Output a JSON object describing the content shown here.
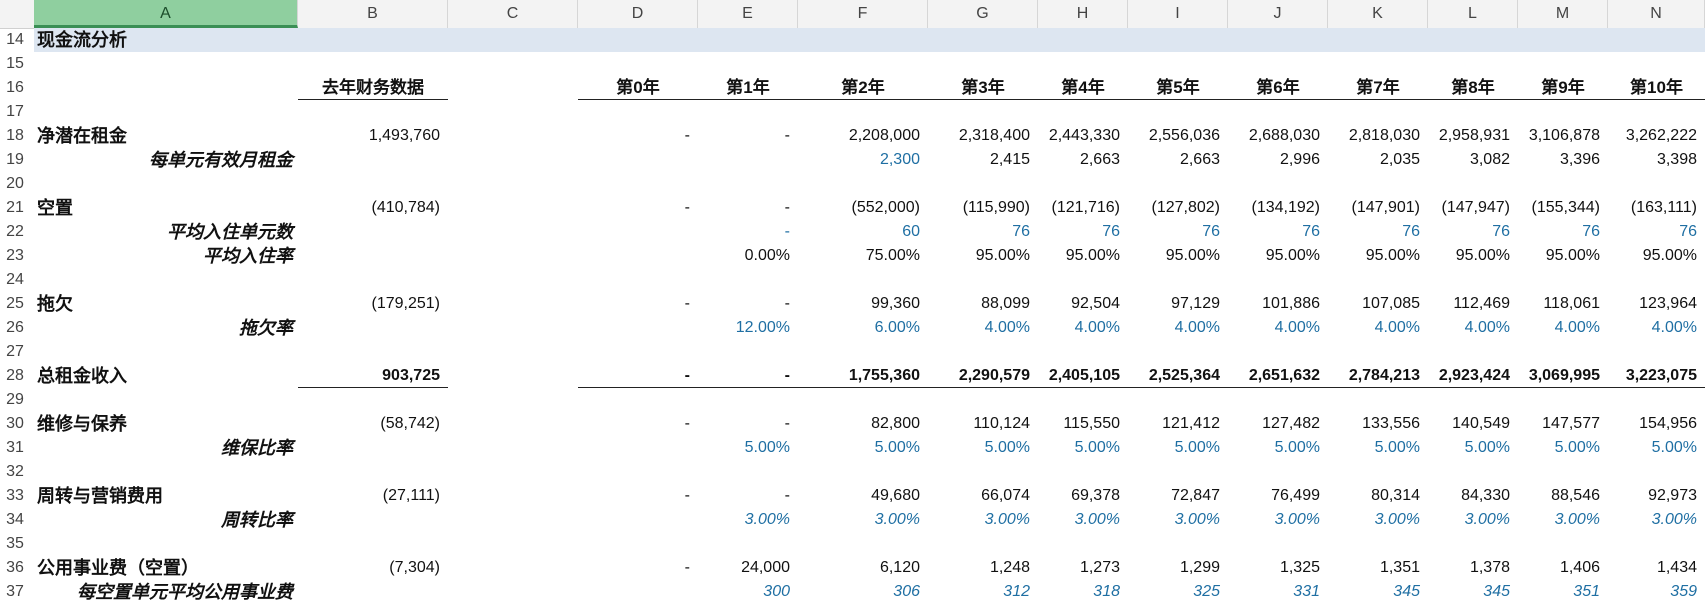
{
  "columns": [
    "A",
    "B",
    "C",
    "D",
    "E",
    "F",
    "G",
    "H",
    "I",
    "J",
    "K",
    "L",
    "M",
    "N"
  ],
  "selected_column": "A",
  "rows": [
    {
      "n": "14",
      "a": "现金流分析",
      "style": "title"
    },
    {
      "n": "15"
    },
    {
      "n": "16",
      "b": "去年财务数据",
      "years": [
        "第0年",
        "第1年",
        "第2年",
        "第3年",
        "第4年",
        "第5年",
        "第6年",
        "第7年",
        "第8年",
        "第9年",
        "第10年"
      ],
      "style": "header"
    },
    {
      "n": "17"
    },
    {
      "n": "18",
      "a": "净潜在租金",
      "b": "1,493,760",
      "v": [
        "-",
        "-",
        "2,208,000",
        "2,318,400",
        "2,443,330",
        "2,556,036",
        "2,688,030",
        "2,818,030",
        "2,958,931",
        "3,106,878",
        "3,262,222"
      ]
    },
    {
      "n": "19",
      "sub": "每单元有效月租金",
      "v": [
        "",
        "",
        "2,300",
        "2,415",
        "2,663",
        "2,663",
        "2,996",
        "2,035",
        "3,082",
        "3,396",
        "3,398"
      ],
      "blue": [
        2
      ]
    },
    {
      "n": "20"
    },
    {
      "n": "21",
      "a": "空置",
      "b": "(410,784)",
      "v": [
        "-",
        "-",
        "(552,000)",
        "(115,990)",
        "(121,716)",
        "(127,802)",
        "(134,192)",
        "(147,901)",
        "(147,947)",
        "(155,344)",
        "(163,111)"
      ]
    },
    {
      "n": "22",
      "sub": "平均入住单元数",
      "v": [
        "",
        "-",
        "60",
        "76",
        "76",
        "76",
        "76",
        "76",
        "76",
        "76",
        "76"
      ],
      "blue": [
        1,
        2,
        3,
        4,
        5,
        6,
        7,
        8,
        9,
        10
      ]
    },
    {
      "n": "23",
      "sub": "平均入住率",
      "v": [
        "",
        "0.00%",
        "75.00%",
        "95.00%",
        "95.00%",
        "95.00%",
        "95.00%",
        "95.00%",
        "95.00%",
        "95.00%",
        "95.00%"
      ]
    },
    {
      "n": "24"
    },
    {
      "n": "25",
      "a": "拖欠",
      "b": "(179,251)",
      "v": [
        "-",
        "-",
        "99,360",
        "88,099",
        "92,504",
        "97,129",
        "101,886",
        "107,085",
        "112,469",
        "118,061",
        "123,964"
      ]
    },
    {
      "n": "26",
      "sub": "拖欠率",
      "v": [
        "",
        "12.00%",
        "6.00%",
        "4.00%",
        "4.00%",
        "4.00%",
        "4.00%",
        "4.00%",
        "4.00%",
        "4.00%",
        "4.00%"
      ],
      "blue": [
        1,
        2,
        3,
        4,
        5,
        6,
        7,
        8,
        9,
        10
      ]
    },
    {
      "n": "27"
    },
    {
      "n": "28",
      "a": "总租金收入",
      "b": "903,725",
      "v": [
        "-",
        "-",
        "1,755,360",
        "2,290,579",
        "2,405,105",
        "2,525,364",
        "2,651,632",
        "2,784,213",
        "2,923,424",
        "3,069,995",
        "3,223,075"
      ],
      "style": "total"
    },
    {
      "n": "29"
    },
    {
      "n": "30",
      "a": "维修与保养",
      "b": "(58,742)",
      "v": [
        "-",
        "-",
        "82,800",
        "110,124",
        "115,550",
        "121,412",
        "127,482",
        "133,556",
        "140,549",
        "147,577",
        "154,956"
      ]
    },
    {
      "n": "31",
      "sub": "维保比率",
      "v": [
        "",
        "5.00%",
        "5.00%",
        "5.00%",
        "5.00%",
        "5.00%",
        "5.00%",
        "5.00%",
        "5.00%",
        "5.00%",
        "5.00%"
      ],
      "blue": [
        1,
        2,
        3,
        4,
        5,
        6,
        7,
        8,
        9,
        10
      ]
    },
    {
      "n": "32"
    },
    {
      "n": "33",
      "a": "周转与营销费用",
      "b": "(27,111)",
      "v": [
        "-",
        "-",
        "49,680",
        "66,074",
        "69,378",
        "72,847",
        "76,499",
        "80,314",
        "84,330",
        "88,546",
        "92,973"
      ]
    },
    {
      "n": "34",
      "sub": "周转比率",
      "v": [
        "",
        "3.00%",
        "3.00%",
        "3.00%",
        "3.00%",
        "3.00%",
        "3.00%",
        "3.00%",
        "3.00%",
        "3.00%",
        "3.00%"
      ],
      "blue": [
        1,
        2,
        3,
        4,
        5,
        6,
        7,
        8,
        9,
        10
      ],
      "italic": true
    },
    {
      "n": "35"
    },
    {
      "n": "36",
      "a": "公用事业费（空置）",
      "b": "(7,304)",
      "v": [
        "-",
        "24,000",
        "6,120",
        "1,248",
        "1,273",
        "1,299",
        "1,325",
        "1,351",
        "1,378",
        "1,406",
        "1,434"
      ]
    },
    {
      "n": "37",
      "sub": "每空置单元平均公用事业费",
      "v": [
        "",
        "300",
        "306",
        "312",
        "318",
        "325",
        "331",
        "345",
        "345",
        "351",
        "359"
      ],
      "blue": [
        1,
        2,
        3,
        4,
        5,
        6,
        7,
        8,
        9,
        10
      ],
      "italic": true
    }
  ]
}
